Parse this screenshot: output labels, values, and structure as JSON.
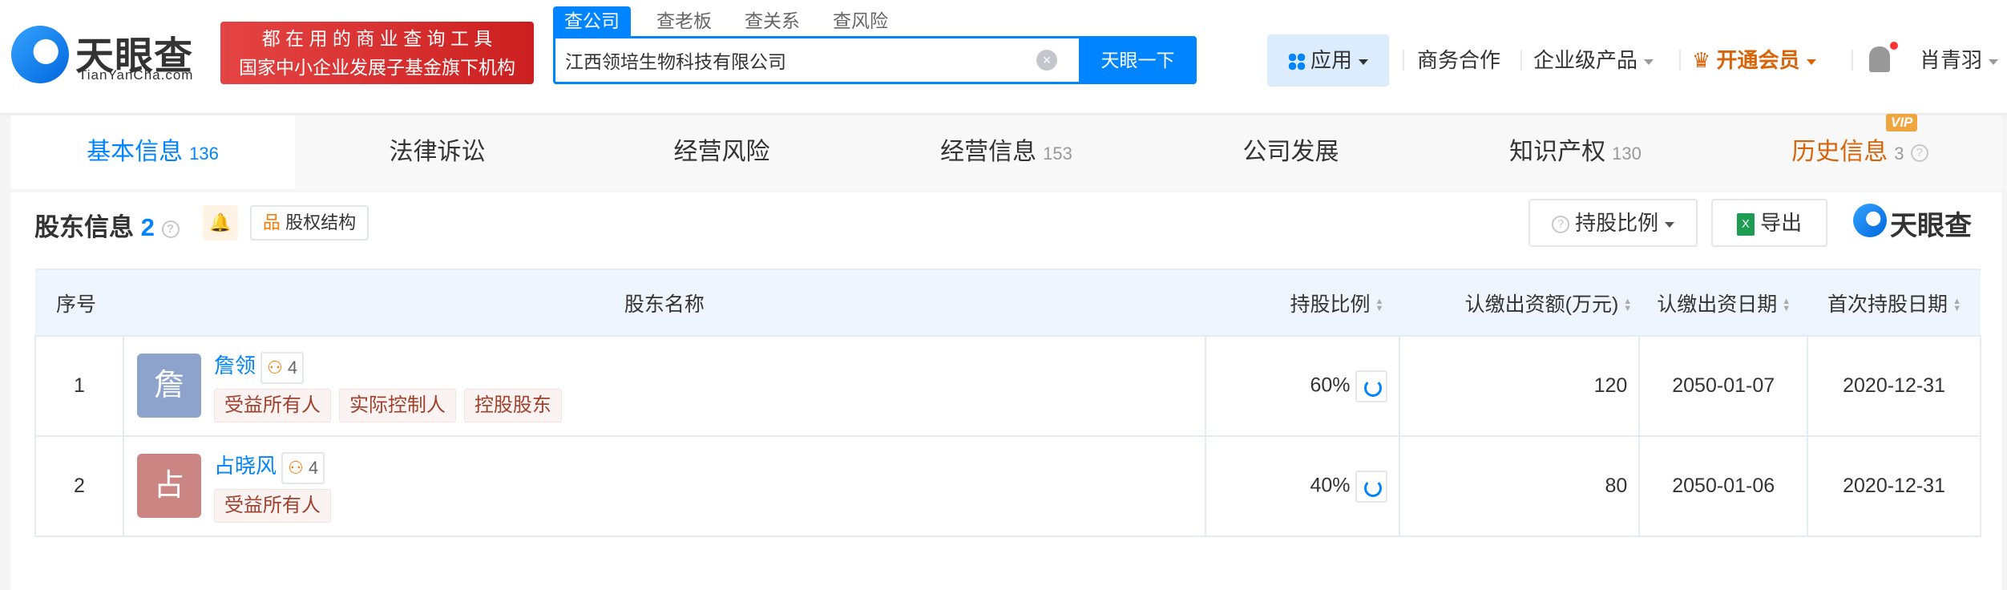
{
  "header": {
    "logo_text": "天眼查",
    "logo_sub": "TianYanCha.com",
    "banner_line1": "都 在 用 的 商 业 查 询 工 具",
    "banner_line2": "国家中小企业发展子基金旗下机构",
    "search_tabs": [
      "查公司",
      "查老板",
      "查关系",
      "查风险"
    ],
    "search_value": "江西领培生物科技有限公司",
    "search_button": "天眼一下",
    "nav": {
      "apps": "应用",
      "business": "商务合作",
      "enterprise": "企业级产品",
      "vip": "开通会员",
      "user": "肖青羽"
    }
  },
  "tabs": [
    {
      "label": "基本信息",
      "count": "136"
    },
    {
      "label": "法律诉讼",
      "count": ""
    },
    {
      "label": "经营风险",
      "count": ""
    },
    {
      "label": "经营信息",
      "count": "153"
    },
    {
      "label": "公司发展",
      "count": ""
    },
    {
      "label": "知识产权",
      "count": "130"
    },
    {
      "label": "历史信息",
      "count": "3",
      "badge": "VIP"
    }
  ],
  "section": {
    "title": "股东信息",
    "count": "2",
    "structure_button": "股权结构",
    "ratio_button": "持股比例",
    "export_button": "导出",
    "brand": "天眼查"
  },
  "table": {
    "columns": [
      "序号",
      "股东名称",
      "持股比例",
      "认缴出资额(万元)",
      "认缴出资日期",
      "首次持股日期"
    ],
    "rows": [
      {
        "index": "1",
        "avatar": "詹",
        "avatar_color": "#8ea3cc",
        "name": "詹领",
        "related": "4",
        "tags": [
          "受益所有人",
          "实际控制人",
          "控股股东"
        ],
        "ratio": "60%",
        "amount": "120",
        "sub_date": "2050-01-07",
        "first_date": "2020-12-31"
      },
      {
        "index": "2",
        "avatar": "占",
        "avatar_color": "#cb8583",
        "name": "占晓风",
        "related": "4",
        "tags": [
          "受益所有人"
        ],
        "ratio": "40%",
        "amount": "80",
        "sub_date": "2050-01-06",
        "first_date": "2020-12-31"
      }
    ]
  }
}
